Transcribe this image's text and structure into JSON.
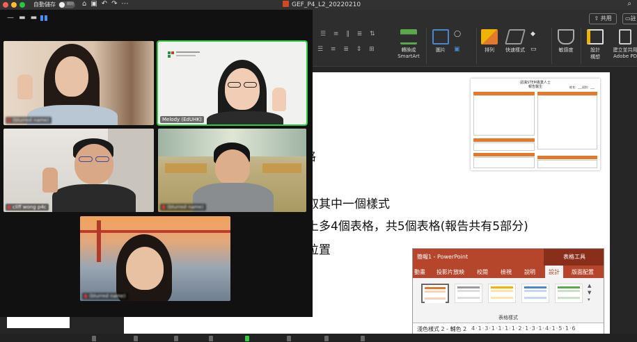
{
  "app": {
    "autosave_label": "自動儲存",
    "autosave_state": "關閉",
    "document_title": "GEF_P4_L2_20220210",
    "share_label": "共用",
    "extra_label": "註"
  },
  "ribbon": {
    "groups": [
      {
        "label": "轉換成\nSmartArt",
        "icon": "smartart-icon"
      },
      {
        "label": "圖片",
        "icon": "picture-icon"
      },
      {
        "label": "排列",
        "icon": "arrange-icon"
      },
      {
        "label": "快速樣式",
        "icon": "quick-styles-icon"
      },
      {
        "label": "敏感度",
        "icon": "sensitivity-icon"
      },
      {
        "label": "設計\n構想",
        "icon": "design-ideas-icon"
      },
      {
        "label": "建立並共用\nAdobe PD",
        "icon": "adobe-pdf-icon"
      }
    ]
  },
  "slide": {
    "lines": [
      "格",
      "取其中一個樣式",
      "上多4個表格，共5個表格(報告共有5部分)",
      "位置"
    ],
    "worksheet": {
      "title_line1": "認識STEM專業人士",
      "title_line2": "報告醫生",
      "name_line": "姓名：___班別：___"
    }
  },
  "powerpoint_inset": {
    "window_title": "簡報1 - PowerPoint",
    "tools_label": "表格工具",
    "tabs": [
      "動畫",
      "投影片放映",
      "校閱",
      "檢視",
      "說明",
      "設計",
      "版面配置"
    ],
    "active_tab": "設計",
    "group_label": "表格樣式",
    "selected_style_name": "淺色樣式 2 - 輔色 2",
    "ruler_text": "4·1·3·1·1·1·1·2·1·3·1·4·1·5·1·6",
    "style_colors": [
      "#e3792b",
      "#9a9a9a",
      "#f0b400",
      "#4a86c8",
      "#5aa84b"
    ]
  },
  "zoom": {
    "participants": [
      {
        "name": "(blurred name)",
        "muted": true
      },
      {
        "name": "Melody (EdUHK)",
        "muted": false,
        "active_speaker": true
      },
      {
        "name": "cliff wong p4c",
        "muted": true
      },
      {
        "name": "(blurred name)",
        "muted": true
      },
      {
        "name": "(blurred name)",
        "muted": true
      }
    ]
  }
}
